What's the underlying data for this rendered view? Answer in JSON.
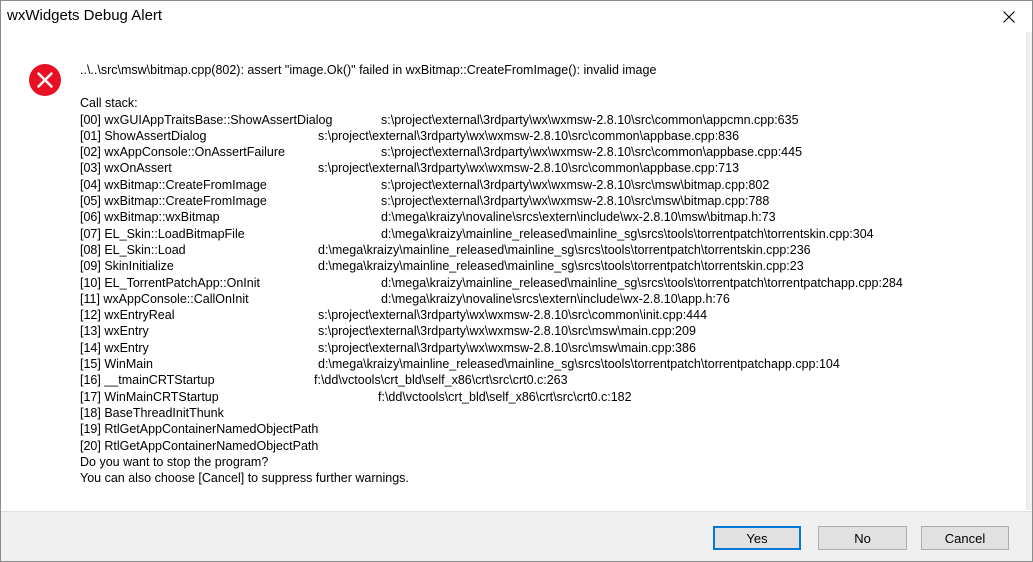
{
  "window": {
    "title": "wxWidgets Debug Alert"
  },
  "icons": {
    "error": "error-icon",
    "close": "close-icon"
  },
  "colors": {
    "error_red": "#e81123",
    "focus_blue": "#0078d7"
  },
  "message": "..\\..\\src\\msw\\bitmap.cpp(802): assert \"image.Ok()\" failed in wxBitmap::CreateFromImage(): invalid image",
  "callstack_label": "Call stack:",
  "frames": [
    {
      "name": "[00] wxGUIAppTraitsBase::ShowAssertDialog",
      "location": "s:\\project\\external\\3rdparty\\wx\\wxmsw-2.8.10\\src\\common\\appcmn.cpp:635"
    },
    {
      "name": "[01] ShowAssertDialog",
      "location": "s:\\project\\external\\3rdparty\\wx\\wxmsw-2.8.10\\src\\common\\appbase.cpp:836"
    },
    {
      "name": "[02] wxAppConsole::OnAssertFailure",
      "location": "s:\\project\\external\\3rdparty\\wx\\wxmsw-2.8.10\\src\\common\\appbase.cpp:445"
    },
    {
      "name": "[03] wxOnAssert",
      "location": "s:\\project\\external\\3rdparty\\wx\\wxmsw-2.8.10\\src\\common\\appbase.cpp:713"
    },
    {
      "name": "[04] wxBitmap::CreateFromImage",
      "location": "s:\\project\\external\\3rdparty\\wx\\wxmsw-2.8.10\\src\\msw\\bitmap.cpp:802"
    },
    {
      "name": "[05] wxBitmap::CreateFromImage",
      "location": "s:\\project\\external\\3rdparty\\wx\\wxmsw-2.8.10\\src\\msw\\bitmap.cpp:788"
    },
    {
      "name": "[06] wxBitmap::wxBitmap",
      "location": "d:\\mega\\kraizy\\novaline\\srcs\\extern\\include\\wx-2.8.10\\msw\\bitmap.h:73"
    },
    {
      "name": "[07] EL_Skin::LoadBitmapFile",
      "location": "d:\\mega\\kraizy\\mainline_released\\mainline_sg\\srcs\\tools\\torrentpatch\\torrentskin.cpp:304"
    },
    {
      "name": "[08] EL_Skin::Load",
      "location": "d:\\mega\\kraizy\\mainline_released\\mainline_sg\\srcs\\tools\\torrentpatch\\torrentskin.cpp:236"
    },
    {
      "name": "[09] SkinInitialize",
      "location": "d:\\mega\\kraizy\\mainline_released\\mainline_sg\\srcs\\tools\\torrentpatch\\torrentskin.cpp:23"
    },
    {
      "name": "[10] EL_TorrentPatchApp::OnInit",
      "location": "d:\\mega\\kraizy\\mainline_released\\mainline_sg\\srcs\\tools\\torrentpatch\\torrentpatchapp.cpp:284"
    },
    {
      "name": "[11] wxAppConsole::CallOnInit",
      "location": "d:\\mega\\kraizy\\novaline\\srcs\\extern\\include\\wx-2.8.10\\app.h:76"
    },
    {
      "name": "[12] wxEntryReal",
      "location": "s:\\project\\external\\3rdparty\\wx\\wxmsw-2.8.10\\src\\common\\init.cpp:444"
    },
    {
      "name": "[13] wxEntry",
      "location": "s:\\project\\external\\3rdparty\\wx\\wxmsw-2.8.10\\src\\msw\\main.cpp:209"
    },
    {
      "name": "[14] wxEntry",
      "location": "s:\\project\\external\\3rdparty\\wx\\wxmsw-2.8.10\\src\\msw\\main.cpp:386"
    },
    {
      "name": "[15] WinMain",
      "location": "d:\\mega\\kraizy\\mainline_released\\mainline_sg\\srcs\\tools\\torrentpatch\\torrentpatchapp.cpp:104"
    },
    {
      "name": "[16] __tmainCRTStartup",
      "location": "f:\\dd\\vctools\\crt_bld\\self_x86\\crt\\src\\crt0.c:263"
    },
    {
      "name": "[17] WinMainCRTStartup",
      "location": "f:\\dd\\vctools\\crt_bld\\self_x86\\crt\\src\\crt0.c:182"
    },
    {
      "name": "[18] BaseThreadInitThunk",
      "location": ""
    },
    {
      "name": "[19] RtlGetAppContainerNamedObjectPath",
      "location": ""
    },
    {
      "name": "[20] RtlGetAppContainerNamedObjectPath",
      "location": ""
    }
  ],
  "question": "Do you want to stop the program?",
  "hint": "You can also choose [Cancel] to suppress further warnings.",
  "buttons": {
    "yes": "Yes",
    "no": "No",
    "cancel": "Cancel"
  }
}
